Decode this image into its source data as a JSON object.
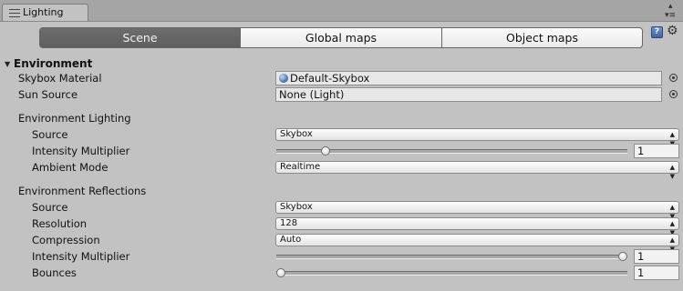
{
  "window": {
    "tab_title": "Lighting",
    "tab_icon": "list-icon",
    "dropdown_icon": "▴",
    "menu_icon": "▾≡"
  },
  "toolbar": {
    "segments": [
      {
        "label": "Scene",
        "active": true
      },
      {
        "label": "Global maps",
        "active": false
      },
      {
        "label": "Object maps",
        "active": false
      }
    ],
    "help_icon": "?",
    "settings_icon": "⚙"
  },
  "environment": {
    "header": "Environment",
    "skybox_material": {
      "label": "Skybox Material",
      "value": "Default-Skybox"
    },
    "sun_source": {
      "label": "Sun Source",
      "value": "None (Light)"
    },
    "lighting": {
      "header": "Environment Lighting",
      "source": {
        "label": "Source",
        "value": "Skybox"
      },
      "intensity": {
        "label": "Intensity Multiplier",
        "value": "1",
        "slider_fraction": 0.13
      },
      "ambient_mode": {
        "label": "Ambient Mode",
        "value": "Realtime"
      }
    },
    "reflections": {
      "header": "Environment Reflections",
      "source": {
        "label": "Source",
        "value": "Skybox"
      },
      "resolution": {
        "label": "Resolution",
        "value": "128"
      },
      "compression": {
        "label": "Compression",
        "value": "Auto"
      },
      "intensity": {
        "label": "Intensity Multiplier",
        "value": "1",
        "slider_fraction": 1.0
      },
      "bounces": {
        "label": "Bounces",
        "value": "1",
        "slider_fraction": 0.0
      }
    }
  },
  "colors": {
    "panel_bg": "#c2c2c2",
    "active_segment": "#666666"
  }
}
